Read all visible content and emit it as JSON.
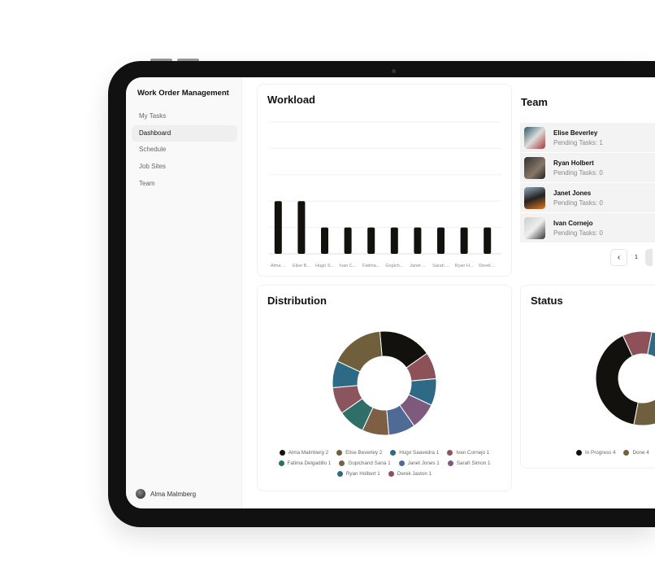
{
  "app": {
    "title": "Work Order Management"
  },
  "sidebar": {
    "items": [
      {
        "label": "My Tasks",
        "active": false
      },
      {
        "label": "Dashboard",
        "active": true
      },
      {
        "label": "Schedule",
        "active": false
      },
      {
        "label": "Job Sites",
        "active": false
      },
      {
        "label": "Team",
        "active": false
      }
    ],
    "user": {
      "name": "Alma Malmberg"
    }
  },
  "workload": {
    "title": "Workload"
  },
  "team": {
    "title": "Team",
    "members": [
      {
        "name": "Elise Beverley",
        "pending": "Pending Tasks: 1"
      },
      {
        "name": "Ryan Holbert",
        "pending": "Pending Tasks: 0"
      },
      {
        "name": "Janet Jones",
        "pending": "Pending Tasks: 0"
      },
      {
        "name": "Ivan Cornejo",
        "pending": "Pending Tasks: 0"
      }
    ],
    "pagination": {
      "current": "1",
      "prev_icon": "chevron-left-icon"
    }
  },
  "distribution": {
    "title": "Distribution"
  },
  "status": {
    "title": "Status"
  },
  "chart_data": [
    {
      "type": "bar",
      "title": "Workload",
      "categories": [
        "Alma ...",
        "Elise B...",
        "Hugo S...",
        "Ivan C...",
        "Fatima...",
        "Gopich...",
        "Janet ...",
        "Sarah ...",
        "Ryan H...",
        "Derek ..."
      ],
      "values": [
        2,
        2,
        1,
        1,
        1,
        1,
        1,
        1,
        1,
        1
      ],
      "ylim": [
        0,
        5
      ],
      "grid": true,
      "color": "#12110d"
    },
    {
      "type": "pie",
      "title": "Distribution",
      "donut": true,
      "legend_position": "bottom",
      "slices": [
        {
          "name": "Alma Malmberg",
          "value": 2,
          "label": "Alma Malmberg 2",
          "color": "#12110d"
        },
        {
          "name": "Elise Beverley",
          "value": 2,
          "label": "Elise Beverley 2",
          "color": "#6f5f3d"
        },
        {
          "name": "Hugo Saavedra",
          "value": 1,
          "label": "Hugo Saavedra 1",
          "color": "#2e6a86"
        },
        {
          "name": "Ivan Cornejo",
          "value": 1,
          "label": "Ivan Cornejo 1",
          "color": "#8b5560"
        },
        {
          "name": "Fatima Delgadillo",
          "value": 1,
          "label": "Fatima Delgadillo 1",
          "color": "#2f6e69"
        },
        {
          "name": "Gopichand Sana",
          "value": 1,
          "label": "Gopichand Sana 1",
          "color": "#7d5f45"
        },
        {
          "name": "Janet Jones",
          "value": 1,
          "label": "Janet Jones 1",
          "color": "#4f6a95"
        },
        {
          "name": "Sarah Simon",
          "value": 1,
          "label": "Sarah Simon 1",
          "color": "#7d5a7e"
        },
        {
          "name": "Ryan Holbert",
          "value": 1,
          "label": "Ryan Holbert 1",
          "color": "#2e6a86"
        },
        {
          "name": "Derek Jaston",
          "value": 1,
          "label": "Derek Jaston 1",
          "color": "#8d5257"
        }
      ]
    },
    {
      "type": "pie",
      "title": "Status",
      "donut": true,
      "legend_position": "bottom",
      "slices": [
        {
          "name": "In Progress",
          "value": 4,
          "label": "In Progress 4",
          "color": "#12110d"
        },
        {
          "name": "Done",
          "value": 4,
          "label": "Done 4",
          "color": "#6f5f3d"
        },
        {
          "name": "",
          "value": 1,
          "label": "",
          "color": "#2e6a86"
        },
        {
          "name": "",
          "value": 1,
          "label": "",
          "color": "#8d5257"
        }
      ]
    }
  ]
}
